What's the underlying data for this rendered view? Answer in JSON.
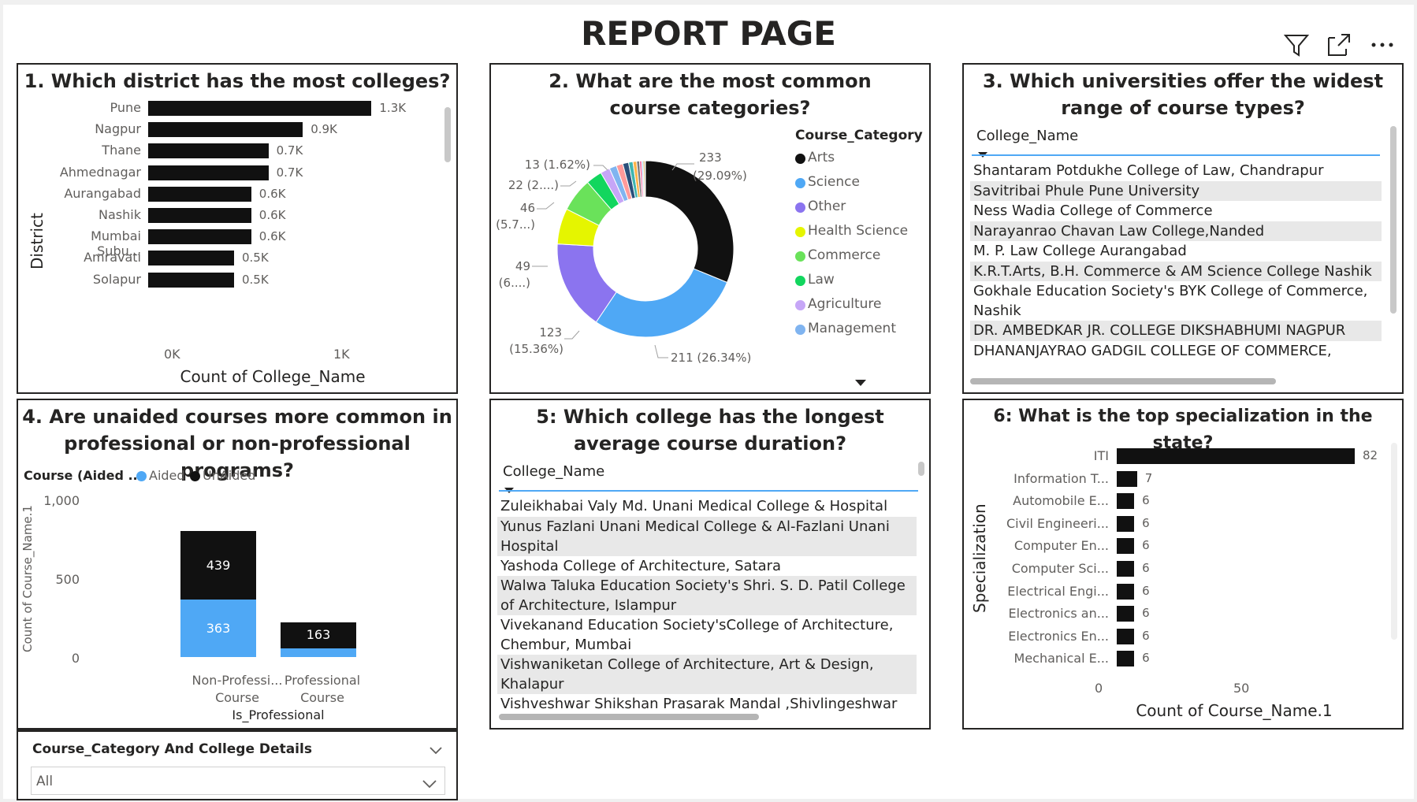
{
  "page": {
    "title": "REPORT PAGE",
    "icons": [
      "filter-icon",
      "focus-mode-icon",
      "more-options-icon"
    ]
  },
  "panel1": {
    "title": "1. Which district has the most colleges?",
    "ylabel": "District",
    "xlabel": "Count of College_Name",
    "xticks": [
      "0K",
      "1K"
    ]
  },
  "panel2": {
    "title": "2. What are the most common course categories?",
    "legend_title": "Course_Category",
    "legend": [
      {
        "name": "Arts",
        "color": "#111111"
      },
      {
        "name": "Science",
        "color": "#4fa8f5"
      },
      {
        "name": "Other",
        "color": "#8b74ef"
      },
      {
        "name": "Health Science",
        "color": "#e5f500"
      },
      {
        "name": "Commerce",
        "color": "#6ae25a"
      },
      {
        "name": "Law",
        "color": "#12d65e"
      },
      {
        "name": "Agriculture",
        "color": "#c6a6f7"
      },
      {
        "name": "Management",
        "color": "#80b4f0"
      }
    ],
    "labels": {
      "arts_count": "233",
      "arts_pct": "(29.09%)",
      "science": "211 (26.34%)",
      "other_count": "123",
      "other_pct": "(15.36%)",
      "hs_count": "49",
      "hs_pct": "(6....)",
      "commerce_count": "46",
      "commerce_pct": "(5.7...)",
      "law": "22 (2....)",
      "agri": "13 (1.62%)"
    }
  },
  "panel3": {
    "title": "3. Which universities offer the widest range of course types?",
    "column": "College_Name",
    "rows": [
      "Shantaram Potdukhe College of Law, Chandrapur",
      "Savitribai Phule Pune University",
      "Ness Wadia College of Commerce",
      "Narayanrao Chavan Law College,Nanded",
      "M. P. Law College Aurangabad",
      "K.R.T.Arts, B.H. Commerce & AM Science College Nashik",
      "Gokhale Education Society's BYK College of Commerce, Nashik",
      "DR. AMBEDKAR JR. COLLEGE DIKSHABHUMI NAGPUR",
      "DHANANJAYRAO GADGIL COLLEGE OF COMMERCE, SATARA"
    ]
  },
  "panel4": {
    "title": "4. Are unaided courses more common in professional or non-professional programs?",
    "legend_title": "Course (Aided ...",
    "legend": [
      {
        "name": "Aided",
        "color": "#4fa8f5"
      },
      {
        "name": "UnAided",
        "color": "#111111"
      }
    ],
    "ylabel": "Count of Course_Name.1",
    "yticks": [
      "1,000",
      "500",
      "0"
    ],
    "xlabel": "Is_Professional",
    "cat1_line1": "Non-Professi...",
    "cat1_line2": "Course",
    "cat2_line1": "Professional",
    "cat2_line2": "Course"
  },
  "panel5": {
    "title": "5: Which college has the longest average course duration?",
    "column": "College_Name",
    "rows": [
      "Zuleikhabai Valy Md. Unani Medical College & Hospital",
      "Yunus Fazlani Unani Medical College & Al-Fazlani Unani Hospital",
      "Yashoda College of Architecture, Satara",
      "Walwa Taluka Education Society's Shri. S. D. Patil College of Architecture, Islampur",
      "Vivekanand Education Society'sCollege of Architecture, Chembur, Mumbai",
      "Vishwaniketan College of Architecture, Art & Design, Khalapur",
      "Vishveshwar Shikshan Prasarak Mandal ,Shivlingeshwar"
    ]
  },
  "panel6": {
    "title": "6: What is the top specialization in the state?",
    "ylabel": "Specialization",
    "xlabel": "Count of Course_Name.1",
    "xticks": [
      "0",
      "50"
    ]
  },
  "slicer": {
    "title": "Course_Category And College Details",
    "value": "All"
  },
  "chart_data": [
    {
      "type": "bar",
      "orientation": "horizontal",
      "title": "1. Which district has the most colleges?",
      "ylabel": "District",
      "xlabel": "Count of College_Name",
      "categories": [
        "Pune",
        "Nagpur",
        "Thane",
        "Ahmednagar",
        "Aurangabad",
        "Nashik",
        "Mumbai Subu...",
        "Amravati",
        "Solapur"
      ],
      "values": [
        1300,
        900,
        700,
        700,
        600,
        600,
        600,
        500,
        500
      ],
      "data_labels": [
        "1.3K",
        "0.9K",
        "0.7K",
        "0.7K",
        "0.6K",
        "0.6K",
        "0.6K",
        "0.5K",
        "0.5K"
      ],
      "xlim": [
        0,
        1350
      ]
    },
    {
      "type": "pie",
      "title": "2. What are the most common course categories?",
      "categories": [
        "Arts",
        "Science",
        "Other",
        "Health Science",
        "Commerce",
        "Law",
        "Agriculture"
      ],
      "values": [
        233,
        211,
        123,
        49,
        46,
        22,
        13
      ],
      "percentages": [
        29.09,
        26.34,
        15.36,
        null,
        null,
        null,
        1.62
      ],
      "other_small_slices": [
        10,
        9,
        8,
        6,
        5,
        4,
        3,
        2,
        2,
        1
      ]
    },
    {
      "type": "bar",
      "stacked": true,
      "title": "4. Are unaided courses more common in professional or non-professional programs?",
      "xlabel": "Is_Professional",
      "ylabel": "Count of Course_Name.1",
      "categories": [
        "Non-Professi... Course",
        "Professional Course"
      ],
      "series": [
        {
          "name": "Aided",
          "values": [
            363,
            57
          ]
        },
        {
          "name": "UnAided",
          "values": [
            439,
            163
          ]
        }
      ],
      "ylim": [
        0,
        1000
      ]
    },
    {
      "type": "bar",
      "orientation": "horizontal",
      "title": "6: What is the top specialization in the state?",
      "ylabel": "Specialization",
      "xlabel": "Count of Course_Name.1",
      "categories": [
        "ITI",
        "Information T...",
        "Automobile E...",
        "Civil Engineeri...",
        "Computer En...",
        "Computer Sci...",
        "Electrical Engi...",
        "Electronics an...",
        "Electronics En...",
        "Mechanical E..."
      ],
      "values": [
        82,
        7,
        6,
        6,
        6,
        6,
        6,
        6,
        6,
        6
      ],
      "xlim": [
        0,
        82
      ]
    }
  ]
}
